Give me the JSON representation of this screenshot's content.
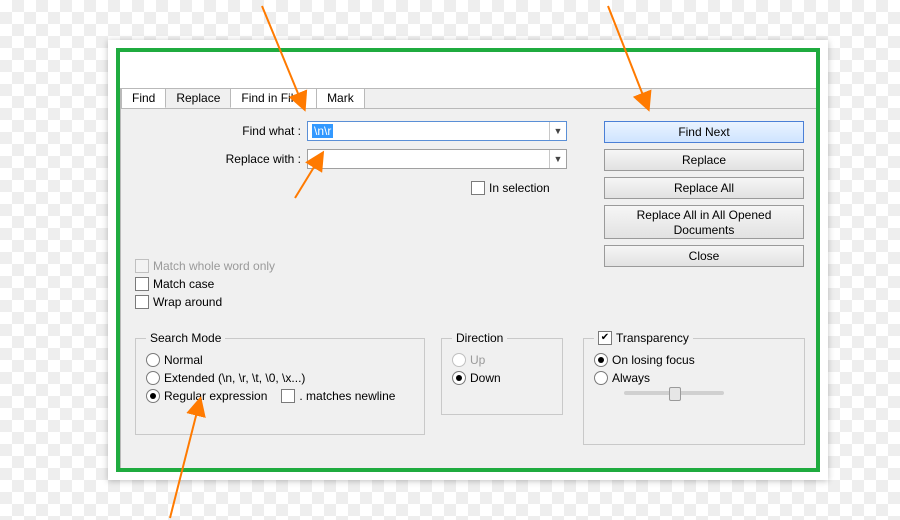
{
  "tabs": {
    "find": "Find",
    "replace": "Replace",
    "find_in_files": "Find in Files",
    "mark": "Mark"
  },
  "labels": {
    "find_what": "Find what :",
    "replace_with": "Replace with :"
  },
  "fields": {
    "find_what_value": "\\n\\r",
    "replace_with_value": ""
  },
  "buttons": {
    "find_next": "Find Next",
    "replace": "Replace",
    "replace_all": "Replace All",
    "replace_all_open": "Replace All in All Opened Documents",
    "close": "Close"
  },
  "options": {
    "in_selection": "In selection",
    "match_whole_word": "Match whole word only",
    "match_case": "Match case",
    "wrap_around": "Wrap around"
  },
  "search_mode": {
    "legend": "Search Mode",
    "normal": "Normal",
    "extended": "Extended (\\n, \\r, \\t, \\0, \\x...)",
    "regex": "Regular expression",
    "matches_newline": ". matches newline"
  },
  "direction": {
    "legend": "Direction",
    "up": "Up",
    "down": "Down"
  },
  "transparency": {
    "legend": "Transparency",
    "on_losing_focus": "On losing focus",
    "always": "Always"
  }
}
